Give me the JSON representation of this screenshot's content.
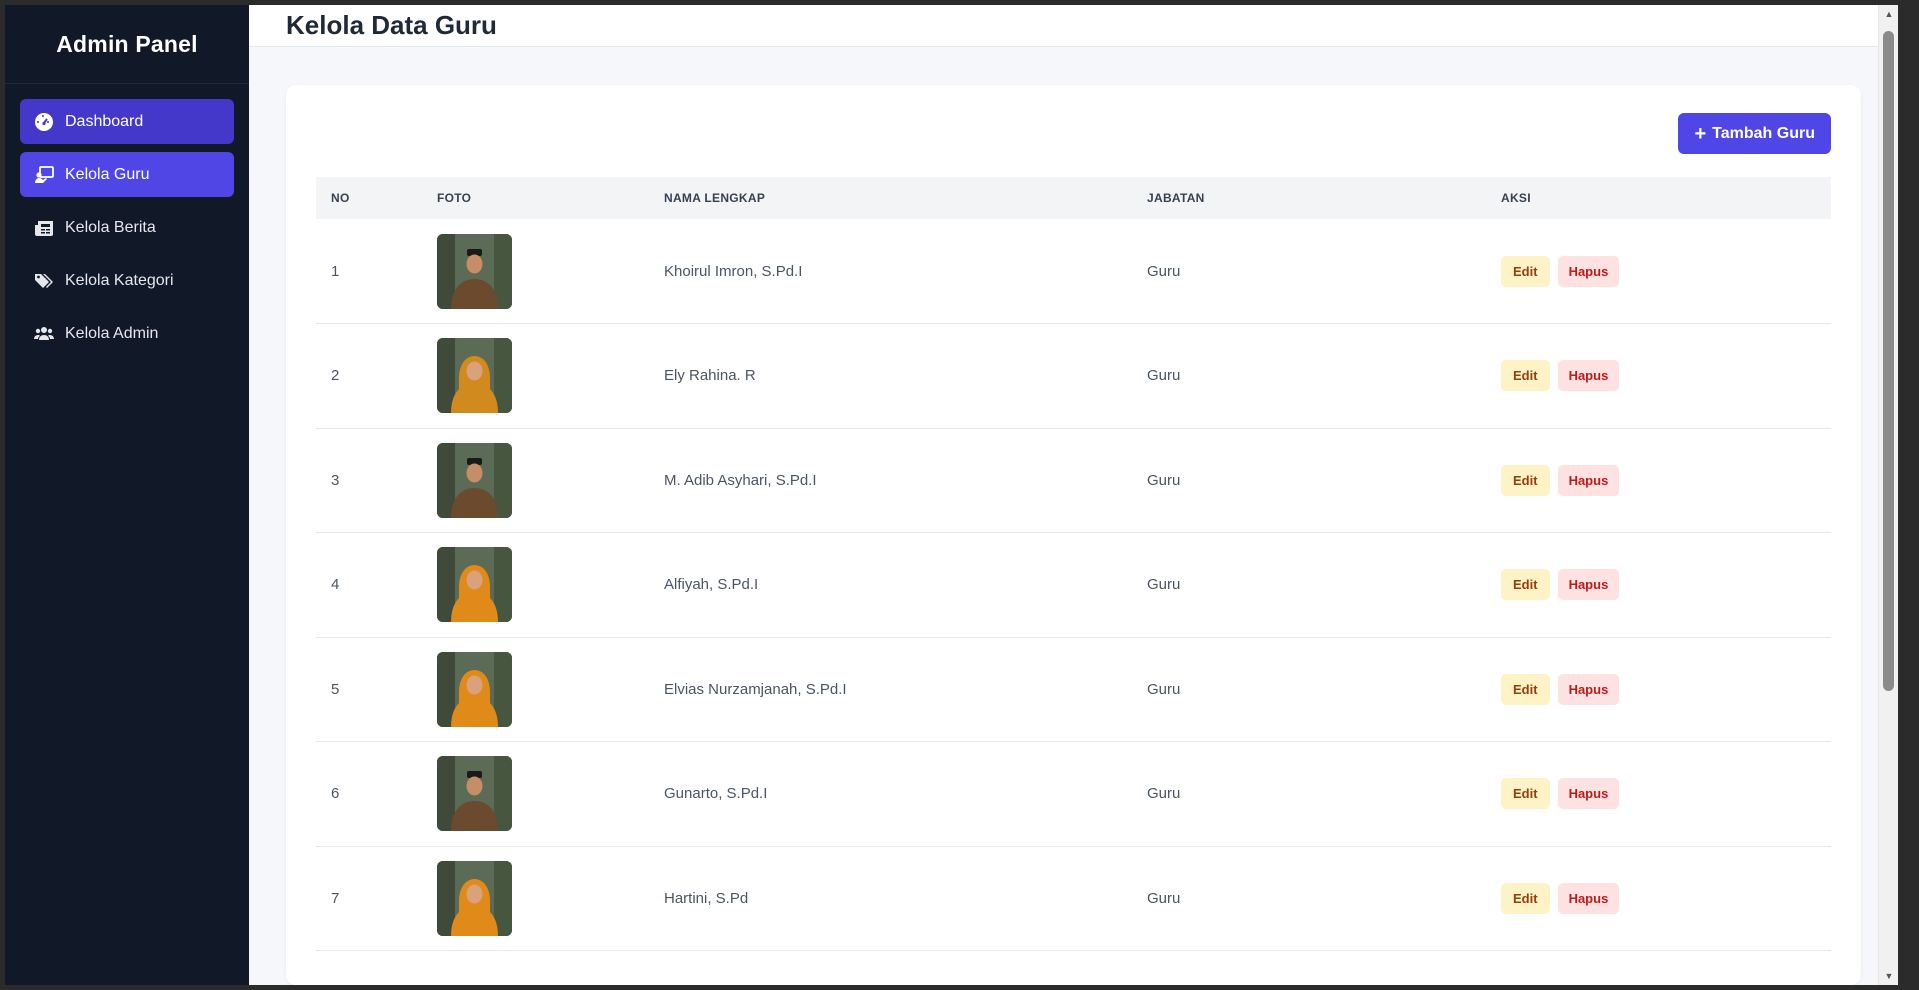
{
  "sidebar": {
    "brand": "Admin Panel",
    "items": [
      {
        "label": "Dashboard",
        "icon": "gauge-icon"
      },
      {
        "label": "Kelola Guru",
        "icon": "teacher-icon"
      },
      {
        "label": "Kelola Berita",
        "icon": "newspaper-icon"
      },
      {
        "label": "Kelola Kategori",
        "icon": "tags-icon"
      },
      {
        "label": "Kelola Admin",
        "icon": "users-icon"
      }
    ]
  },
  "header": {
    "title": "Kelola Data Guru"
  },
  "toolbar": {
    "add_label": "Tambah Guru"
  },
  "table": {
    "columns": [
      "NO",
      "FOTO",
      "NAMA LENGKAP",
      "JABATAN",
      "AKSI"
    ],
    "edit_label": "Edit",
    "delete_label": "Hapus",
    "rows": [
      {
        "no": "1",
        "nama": "Khoirul Imron, S.Pd.I",
        "jabatan": "Guru",
        "photo_tone": "#6b4a2e"
      },
      {
        "no": "2",
        "nama": "Ely Rahina. R",
        "jabatan": "Guru",
        "photo_tone": "#d08a1e"
      },
      {
        "no": "3",
        "nama": "M. Adib Asyhari, S.Pd.I",
        "jabatan": "Guru",
        "photo_tone": "#6b4a2e"
      },
      {
        "no": "4",
        "nama": "Alfiyah, S.Pd.I",
        "jabatan": "Guru",
        "photo_tone": "#e08a1a"
      },
      {
        "no": "5",
        "nama": "Elvias Nurzamjanah, S.Pd.I",
        "jabatan": "Guru",
        "photo_tone": "#e08a1a"
      },
      {
        "no": "6",
        "nama": "Gunarto, S.Pd.I",
        "jabatan": "Guru",
        "photo_tone": "#6b4a2e"
      },
      {
        "no": "7",
        "nama": "Hartini, S.Pd",
        "jabatan": "Guru",
        "photo_tone": "#e08a1a"
      }
    ]
  },
  "colors": {
    "sidebar_bg": "#111827",
    "accent": "#4f46e5",
    "edit_bg": "#fef3c7",
    "delete_bg": "#fee2e2"
  }
}
